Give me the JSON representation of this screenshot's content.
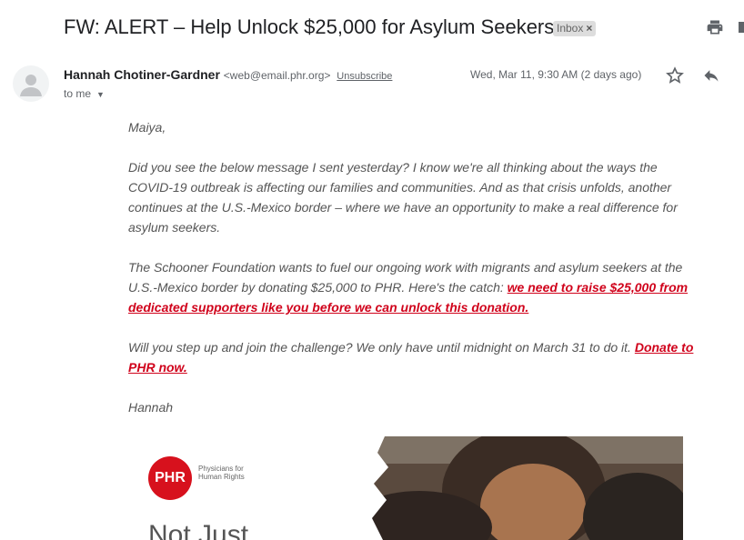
{
  "email": {
    "subject": "FW: ALERT – Help Unlock $25,000 for Asylum Seekers",
    "label": "Inbox",
    "label_close": "×",
    "sender_name": "Hannah Chotiner-Gardner",
    "sender_email": "<web@email.phr.org>",
    "unsubscribe": "Unsubscribe",
    "to": "to me",
    "date": "Wed, Mar 11, 9:30 AM (2 days ago)",
    "body": {
      "greeting": "Maiya,",
      "p1": "Did you see the below message I sent yesterday? I know we're all thinking about the ways the COVID-19 outbreak is affecting our families and communities. And as that crisis unfolds, another continues at the U.S.-Mexico border – where we have an opportunity to make a real difference for asylum seekers.",
      "p2_text": "The Schooner Foundation wants to fuel our ongoing work with migrants and asylum seekers at the U.S.-Mexico border by donating $25,000 to PHR. Here's the catch: ",
      "p2_link": "we need to raise $25,000 from dedicated supporters like you before we can unlock this donation.",
      "p3_text": "Will you step up and join the challenge? We only have until midnight on March 31 to do it. ",
      "p3_link": "Donate to PHR now.",
      "signoff": "Hannah"
    },
    "banner": {
      "logo": "PHR",
      "org_line1": "Physicians for",
      "org_line2": "Human Rights",
      "headline": "Not Just"
    }
  },
  "icons": {
    "print": "print-icon",
    "star": "star-icon",
    "reply": "reply-icon",
    "avatar": "person-icon",
    "chevron": "chevron-down-icon"
  }
}
